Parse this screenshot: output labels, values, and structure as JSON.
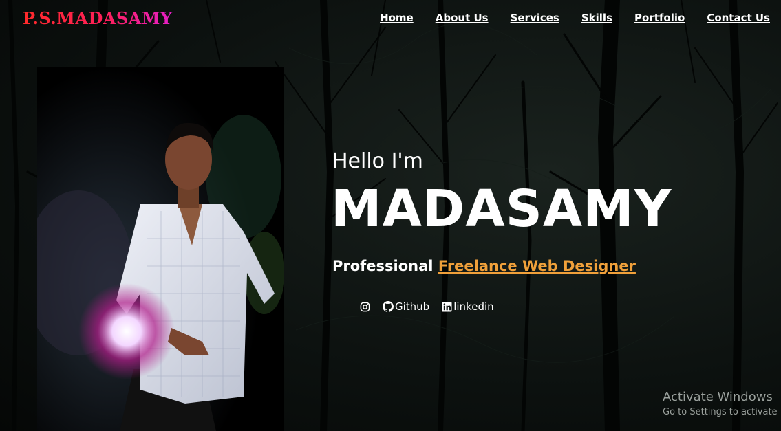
{
  "brand": {
    "logo": "P.S.MADASAMY"
  },
  "nav": {
    "items": [
      "Home",
      "About Us",
      "Services",
      "Skills",
      "Portfolio",
      "Contact Us"
    ]
  },
  "hero": {
    "greeting": "Hello I'm",
    "name": "MADASAMY",
    "tagline_prefix": "Professional",
    "tagline_role": "Freelance Web Designer",
    "accent_color": "#f0a03a"
  },
  "social": {
    "instagram_icon": "instagram-icon",
    "github_label": " Github",
    "linkedin_label": " linkedin"
  },
  "watermark": {
    "line1": "Activate Windows",
    "line2": "Go to Settings to activate"
  }
}
